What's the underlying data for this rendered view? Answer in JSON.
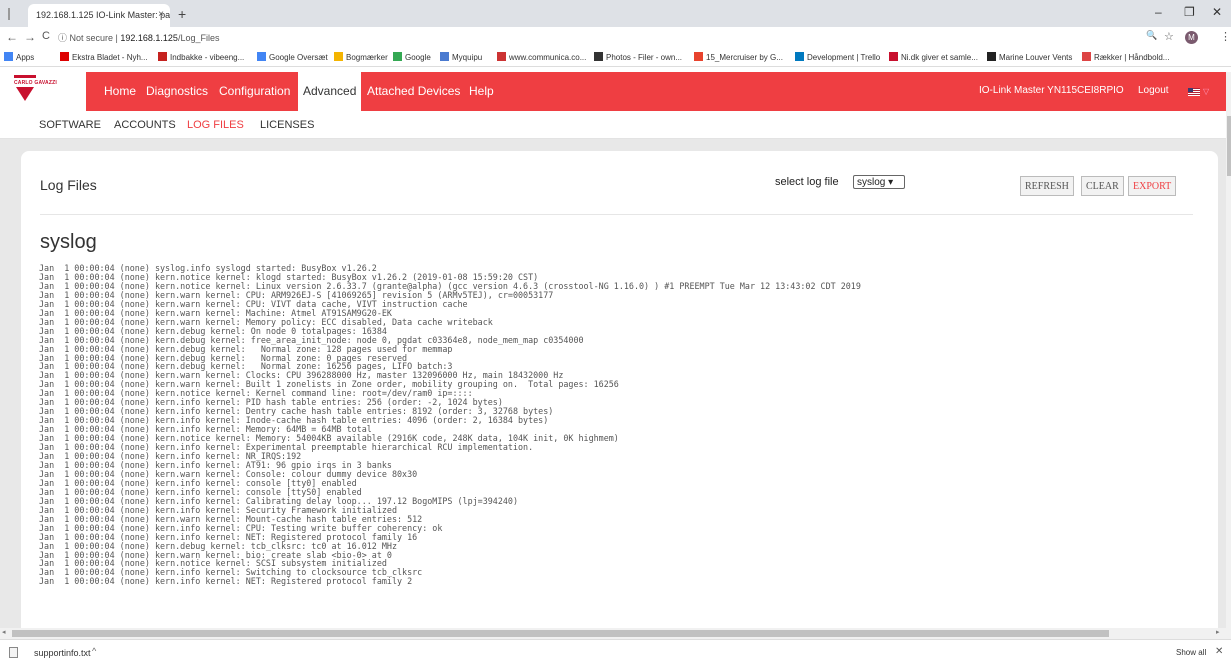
{
  "browser": {
    "tab_title": "192.168.1.125 IO-Link Master: pa",
    "tab_close": "×",
    "new_tab": "+",
    "win_min": "–",
    "win_max": "❐",
    "win_close": "✕",
    "back": "←",
    "forward": "→",
    "reload": "C",
    "security_label": "ⓘ Not secure |",
    "url_host": "192.168.1.125",
    "url_path": "/Log_Files",
    "zoom_icon": "🔍",
    "star_icon": "☆",
    "avatar_letter": "M",
    "menu_icon": "⋮"
  },
  "bookmarks": [
    {
      "label": "Apps",
      "color": "#4285f4"
    },
    {
      "label": "Ekstra Bladet - Nyh...",
      "color": "#d00"
    },
    {
      "label": "Indbakke - vibeeng...",
      "color": "#c5221f"
    },
    {
      "label": "Google Oversæt",
      "color": "#4285f4"
    },
    {
      "label": "Bogmærker",
      "color": "#f4b400"
    },
    {
      "label": "Google",
      "color": "#34a853"
    },
    {
      "label": "Myquipu",
      "color": "#4a7ad0"
    },
    {
      "label": "www.communica.co...",
      "color": "#c33"
    },
    {
      "label": "Photos - Filer - own...",
      "color": "#333"
    },
    {
      "label": "15_Mercruiser by G...",
      "color": "#e8432d"
    },
    {
      "label": "Development | Trello",
      "color": "#0079bf"
    },
    {
      "label": "Ni.dk giver et samle...",
      "color": "#c8102e"
    },
    {
      "label": "Marine Louver Vents",
      "color": "#222"
    },
    {
      "label": "Rækker | Håndbold...",
      "color": "#d44"
    }
  ],
  "header": {
    "logo_text": "CARLO GAVAZZI",
    "nav": [
      "Home",
      "Diagnostics",
      "Configuration",
      "Advanced",
      "Attached Devices",
      "Help"
    ],
    "active_nav": "Advanced",
    "device_name": "IO-Link Master YN115CEI8RPIO",
    "logout": "Logout",
    "lang_caret": "▽"
  },
  "subnav": {
    "items": [
      "SOFTWARE",
      "ACCOUNTS",
      "LOG FILES",
      "LICENSES"
    ],
    "active": "LOG FILES"
  },
  "page": {
    "title": "Log Files",
    "select_label": "select log file",
    "select_value": "syslog ▾",
    "buttons": {
      "refresh": "REFRESH",
      "clear": "CLEAR",
      "export": "EXPORT"
    },
    "log_name": "syslog",
    "log_lines": [
      "Jan  1 00:00:04 (none) syslog.info syslogd started: BusyBox v1.26.2",
      "Jan  1 00:00:04 (none) kern.notice kernel: klogd started: BusyBox v1.26.2 (2019-01-08 15:59:20 CST)",
      "Jan  1 00:00:04 (none) kern.notice kernel: Linux version 2.6.33.7 (grante@alpha) (gcc version 4.6.3 (crosstool-NG 1.16.0) ) #1 PREEMPT Tue Mar 12 13:43:02 CDT 2019",
      "Jan  1 00:00:04 (none) kern.warn kernel: CPU: ARM926EJ-S [41069265] revision 5 (ARMv5TEJ), cr=00053177",
      "Jan  1 00:00:04 (none) kern.warn kernel: CPU: VIVT data cache, VIVT instruction cache",
      "Jan  1 00:00:04 (none) kern.warn kernel: Machine: Atmel AT91SAM9G20-EK",
      "Jan  1 00:00:04 (none) kern.warn kernel: Memory policy: ECC disabled, Data cache writeback",
      "Jan  1 00:00:04 (none) kern.debug kernel: On node 0 totalpages: 16384",
      "Jan  1 00:00:04 (none) kern.debug kernel: free_area_init_node: node 0, pgdat c03364e8, node_mem_map c0354000",
      "Jan  1 00:00:04 (none) kern.debug kernel:   Normal zone: 128 pages used for memmap",
      "Jan  1 00:00:04 (none) kern.debug kernel:   Normal zone: 0 pages reserved",
      "Jan  1 00:00:04 (none) kern.debug kernel:   Normal zone: 16256 pages, LIFO batch:3",
      "Jan  1 00:00:04 (none) kern.warn kernel: Clocks: CPU 396288000 Hz, master 132096000 Hz, main 18432000 Hz",
      "Jan  1 00:00:04 (none) kern.warn kernel: Built 1 zonelists in Zone order, mobility grouping on.  Total pages: 16256",
      "Jan  1 00:00:04 (none) kern.notice kernel: Kernel command line: root=/dev/ram0 ip=::::",
      "Jan  1 00:00:04 (none) kern.info kernel: PID hash table entries: 256 (order: -2, 1024 bytes)",
      "Jan  1 00:00:04 (none) kern.info kernel: Dentry cache hash table entries: 8192 (order: 3, 32768 bytes)",
      "Jan  1 00:00:04 (none) kern.info kernel: Inode-cache hash table entries: 4096 (order: 2, 16384 bytes)",
      "Jan  1 00:00:04 (none) kern.info kernel: Memory: 64MB = 64MB total",
      "Jan  1 00:00:04 (none) kern.notice kernel: Memory: 54004KB available (2916K code, 248K data, 104K init, 0K highmem)",
      "Jan  1 00:00:04 (none) kern.info kernel: Experimental preemptable hierarchical RCU implementation.",
      "Jan  1 00:00:04 (none) kern.info kernel: NR_IRQS:192",
      "Jan  1 00:00:04 (none) kern.info kernel: AT91: 96 gpio irqs in 3 banks",
      "Jan  1 00:00:04 (none) kern.warn kernel: Console: colour dummy device 80x30",
      "Jan  1 00:00:04 (none) kern.info kernel: console [tty0] enabled",
      "Jan  1 00:00:04 (none) kern.info kernel: console [ttyS0] enabled",
      "Jan  1 00:00:04 (none) kern.info kernel: Calibrating delay loop... 197.12 BogoMIPS (lpj=394240)",
      "Jan  1 00:00:04 (none) kern.info kernel: Security Framework initialized",
      "Jan  1 00:00:04 (none) kern.warn kernel: Mount-cache hash table entries: 512",
      "Jan  1 00:00:04 (none) kern.info kernel: CPU: Testing write buffer coherency: ok",
      "Jan  1 00:00:04 (none) kern.info kernel: NET: Registered protocol family 16",
      "Jan  1 00:00:04 (none) kern.debug kernel: tcb_clksrc: tc0 at 16.012 MHz",
      "Jan  1 00:00:04 (none) kern.warn kernel: bio: create slab <bio-0> at 0",
      "Jan  1 00:00:04 (none) kern.notice kernel: SCSI subsystem initialized",
      "Jan  1 00:00:04 (none) kern.info kernel: Switching to clocksource tcb_clksrc",
      "Jan  1 00:00:04 (none) kern.info kernel: NET: Registered protocol family 2"
    ]
  },
  "downloads": {
    "file": "supportinfo.txt",
    "caret": "^",
    "show_all": "Show all",
    "close": "✕"
  }
}
